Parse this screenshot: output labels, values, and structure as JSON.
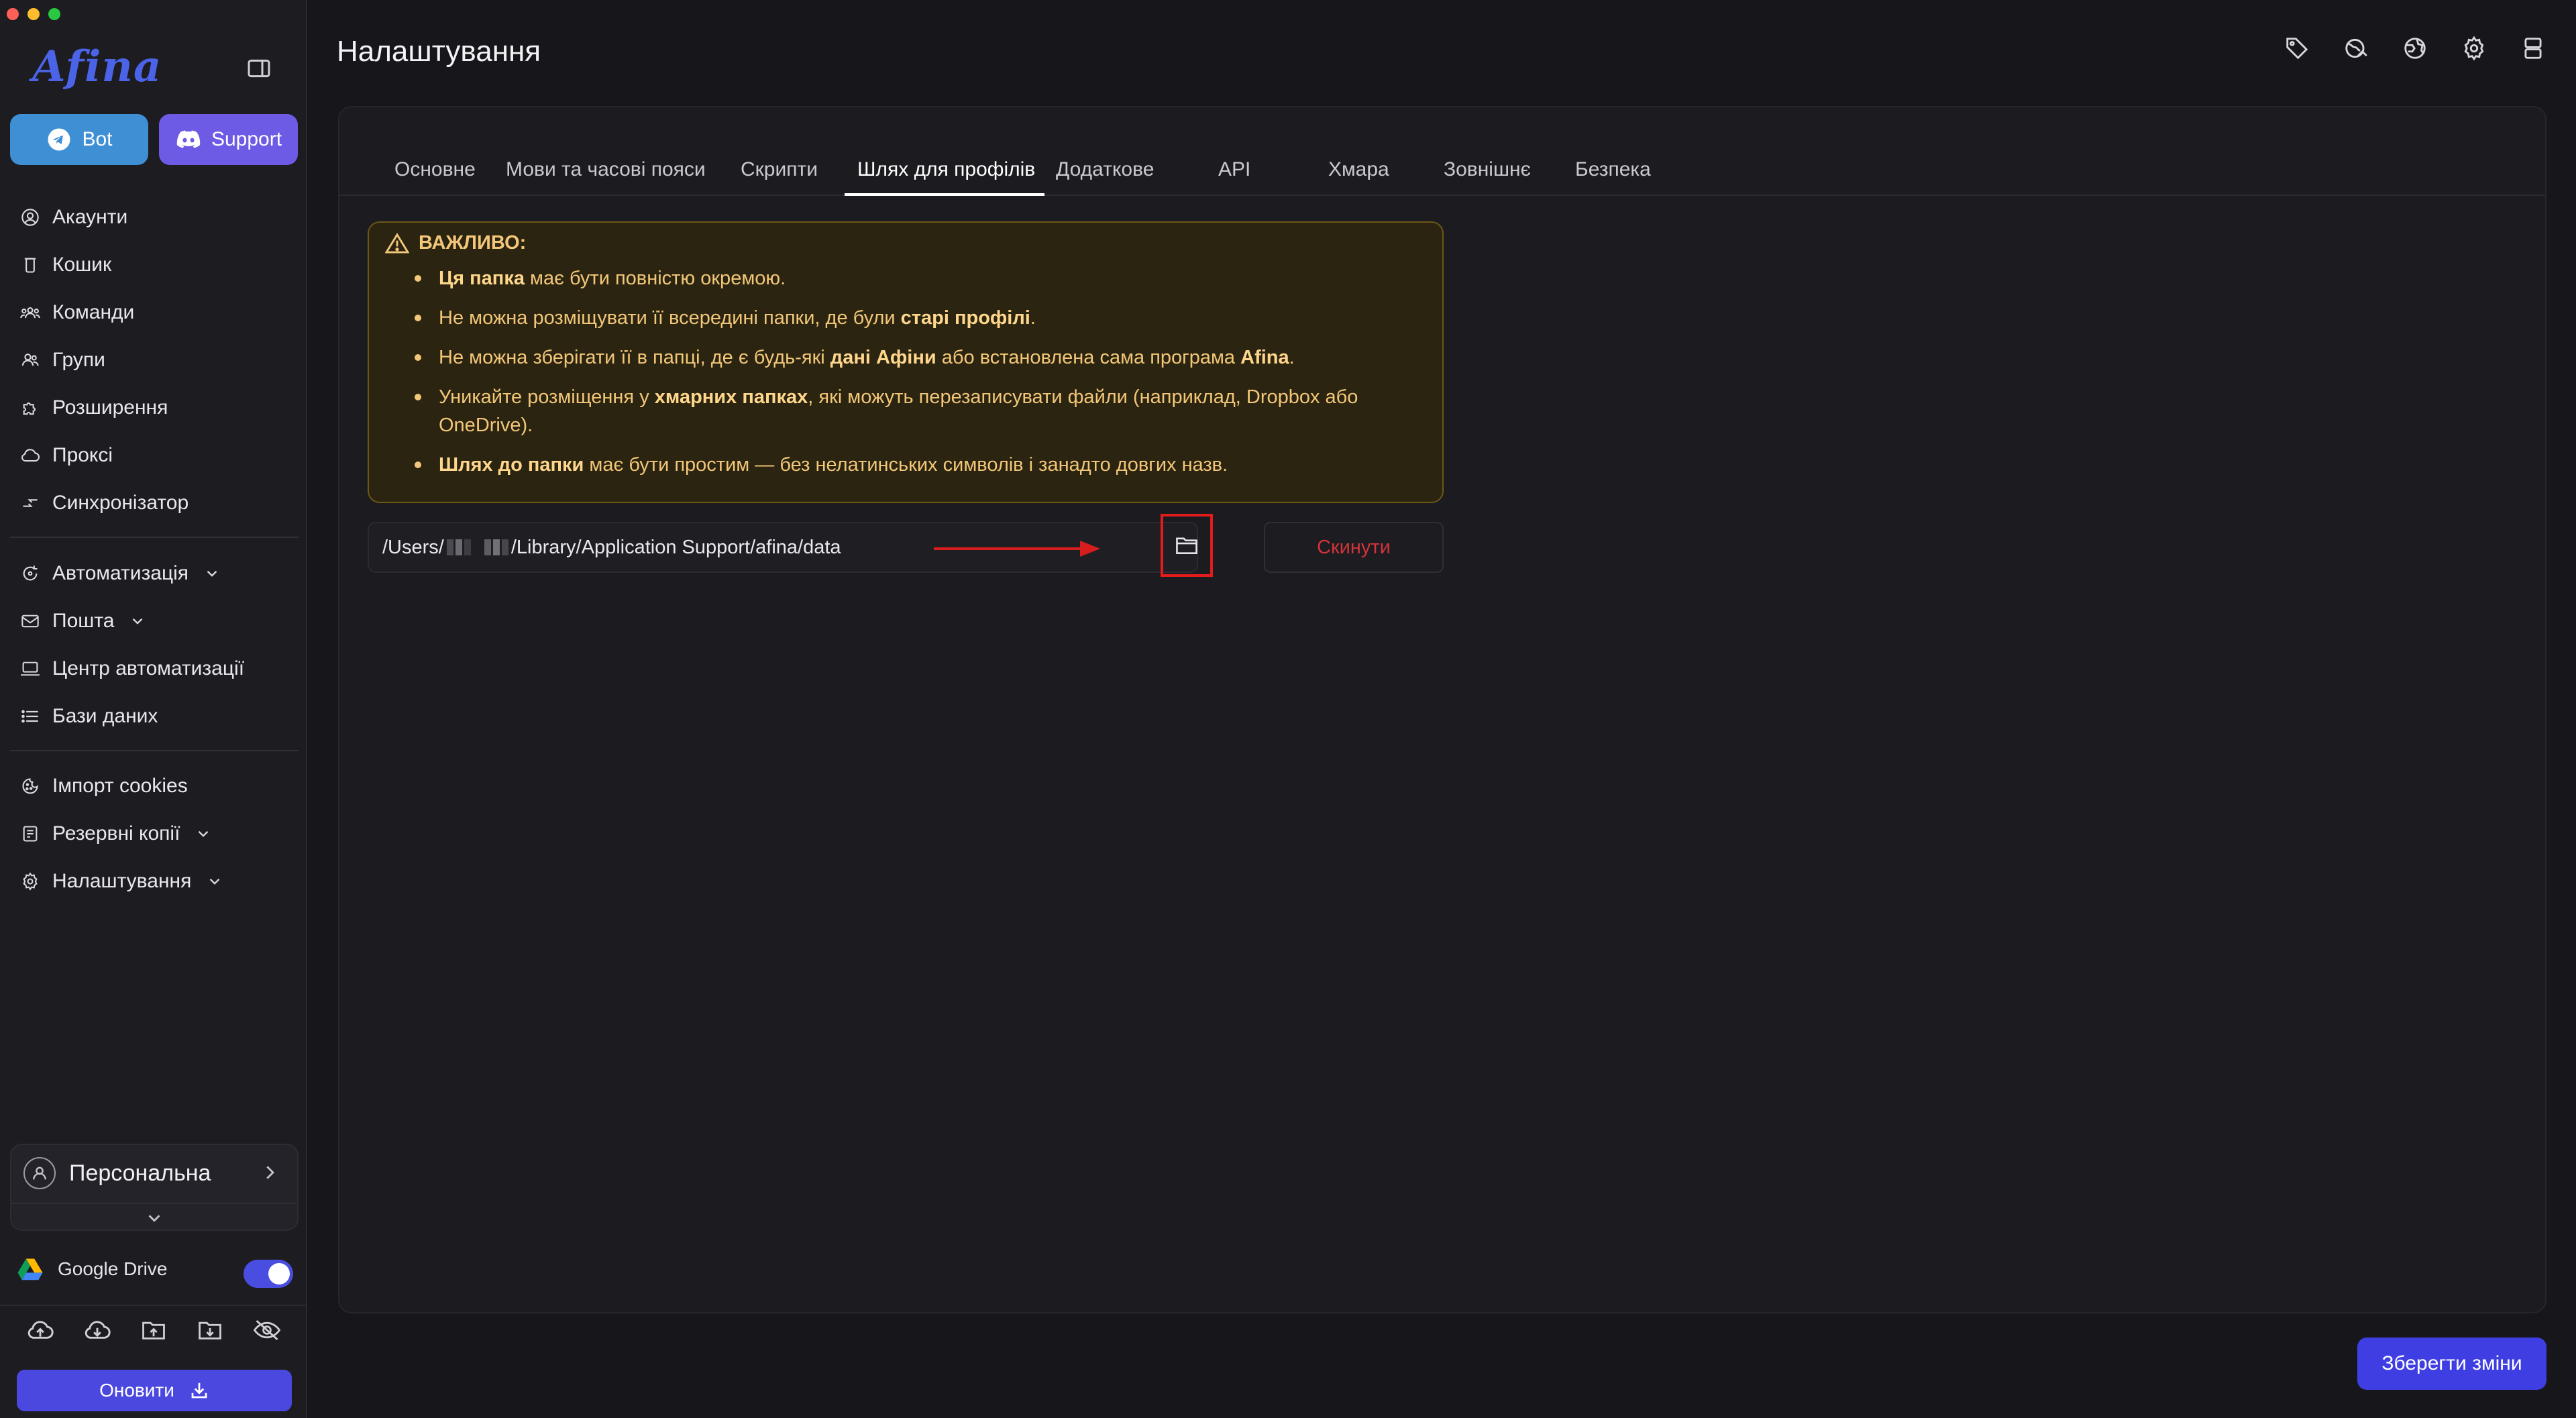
{
  "app": {
    "logo_text": "Afina"
  },
  "sidebar": {
    "bot_label": "Bot",
    "support_label": "Support",
    "items": [
      {
        "label": "Акаунти",
        "icon": "user-circle-icon"
      },
      {
        "label": "Кошик",
        "icon": "trash-icon"
      },
      {
        "label": "Команди",
        "icon": "team-icon"
      },
      {
        "label": "Групи",
        "icon": "users-icon"
      },
      {
        "label": "Розширення",
        "icon": "puzzle-icon"
      },
      {
        "label": "Проксі",
        "icon": "cloud-icon"
      },
      {
        "label": "Синхронізатор",
        "icon": "sync-icon"
      },
      {
        "label": "Автоматизація",
        "icon": "automation-icon"
      },
      {
        "label": "Пошта",
        "icon": "mail-icon"
      },
      {
        "label": "Центр автоматизації",
        "icon": "laptop-icon"
      },
      {
        "label": "Бази даних",
        "icon": "list-icon"
      },
      {
        "label": "Імпорт cookies",
        "icon": "cookie-icon"
      },
      {
        "label": "Резервні копії",
        "icon": "backup-icon"
      },
      {
        "label": "Налаштування",
        "icon": "gear-icon"
      }
    ],
    "workspace": {
      "name": "Персональна"
    },
    "google_drive": {
      "label": "Google Drive",
      "enabled": true
    },
    "update_label": "Оновити"
  },
  "header": {
    "title": "Налаштування"
  },
  "tabs": [
    {
      "label": "Основне"
    },
    {
      "label": "Мови та часові пояси"
    },
    {
      "label": "Скрипти"
    },
    {
      "label": "Шлях для профілів",
      "active": true
    },
    {
      "label": "Додаткове"
    },
    {
      "label": "API"
    },
    {
      "label": "Хмара"
    },
    {
      "label": "Зовнішнє"
    },
    {
      "label": "Безпека"
    }
  ],
  "warning": {
    "title": "ВАЖЛИВО:",
    "items": [
      {
        "bold": "Ця папка",
        "text": " має бути повністю окремою."
      },
      {
        "pre": "Не можна розміщувати її всередині папки, де були ",
        "bold": "старі профілі",
        "post": "."
      },
      {
        "pre": "Не можна зберігати її в папці, де є будь-які ",
        "bold": "дані Афіни",
        "mid": " або встановлена сама програма ",
        "bold2": "Afina",
        "post": "."
      },
      {
        "pre": "Уникайте розміщення у ",
        "bold": "хмарних папках",
        "post": ", які можуть перезаписувати файли (наприклад, Dropbox або OneDrive)."
      },
      {
        "bold": "Шлях до папки",
        "text": " має бути простим — без нелатинських символів і занадто довгих назв."
      }
    ]
  },
  "path": {
    "prefix": "/Users/",
    "suffix": "/Library/Application Support/afina/data"
  },
  "reset_label": "Скинути",
  "save_label": "Зберегти зміни",
  "colors": {
    "accent": "#4b48e0",
    "warning_text": "#f3c779",
    "danger": "#d2343b",
    "highlight": "#e21b1b"
  }
}
